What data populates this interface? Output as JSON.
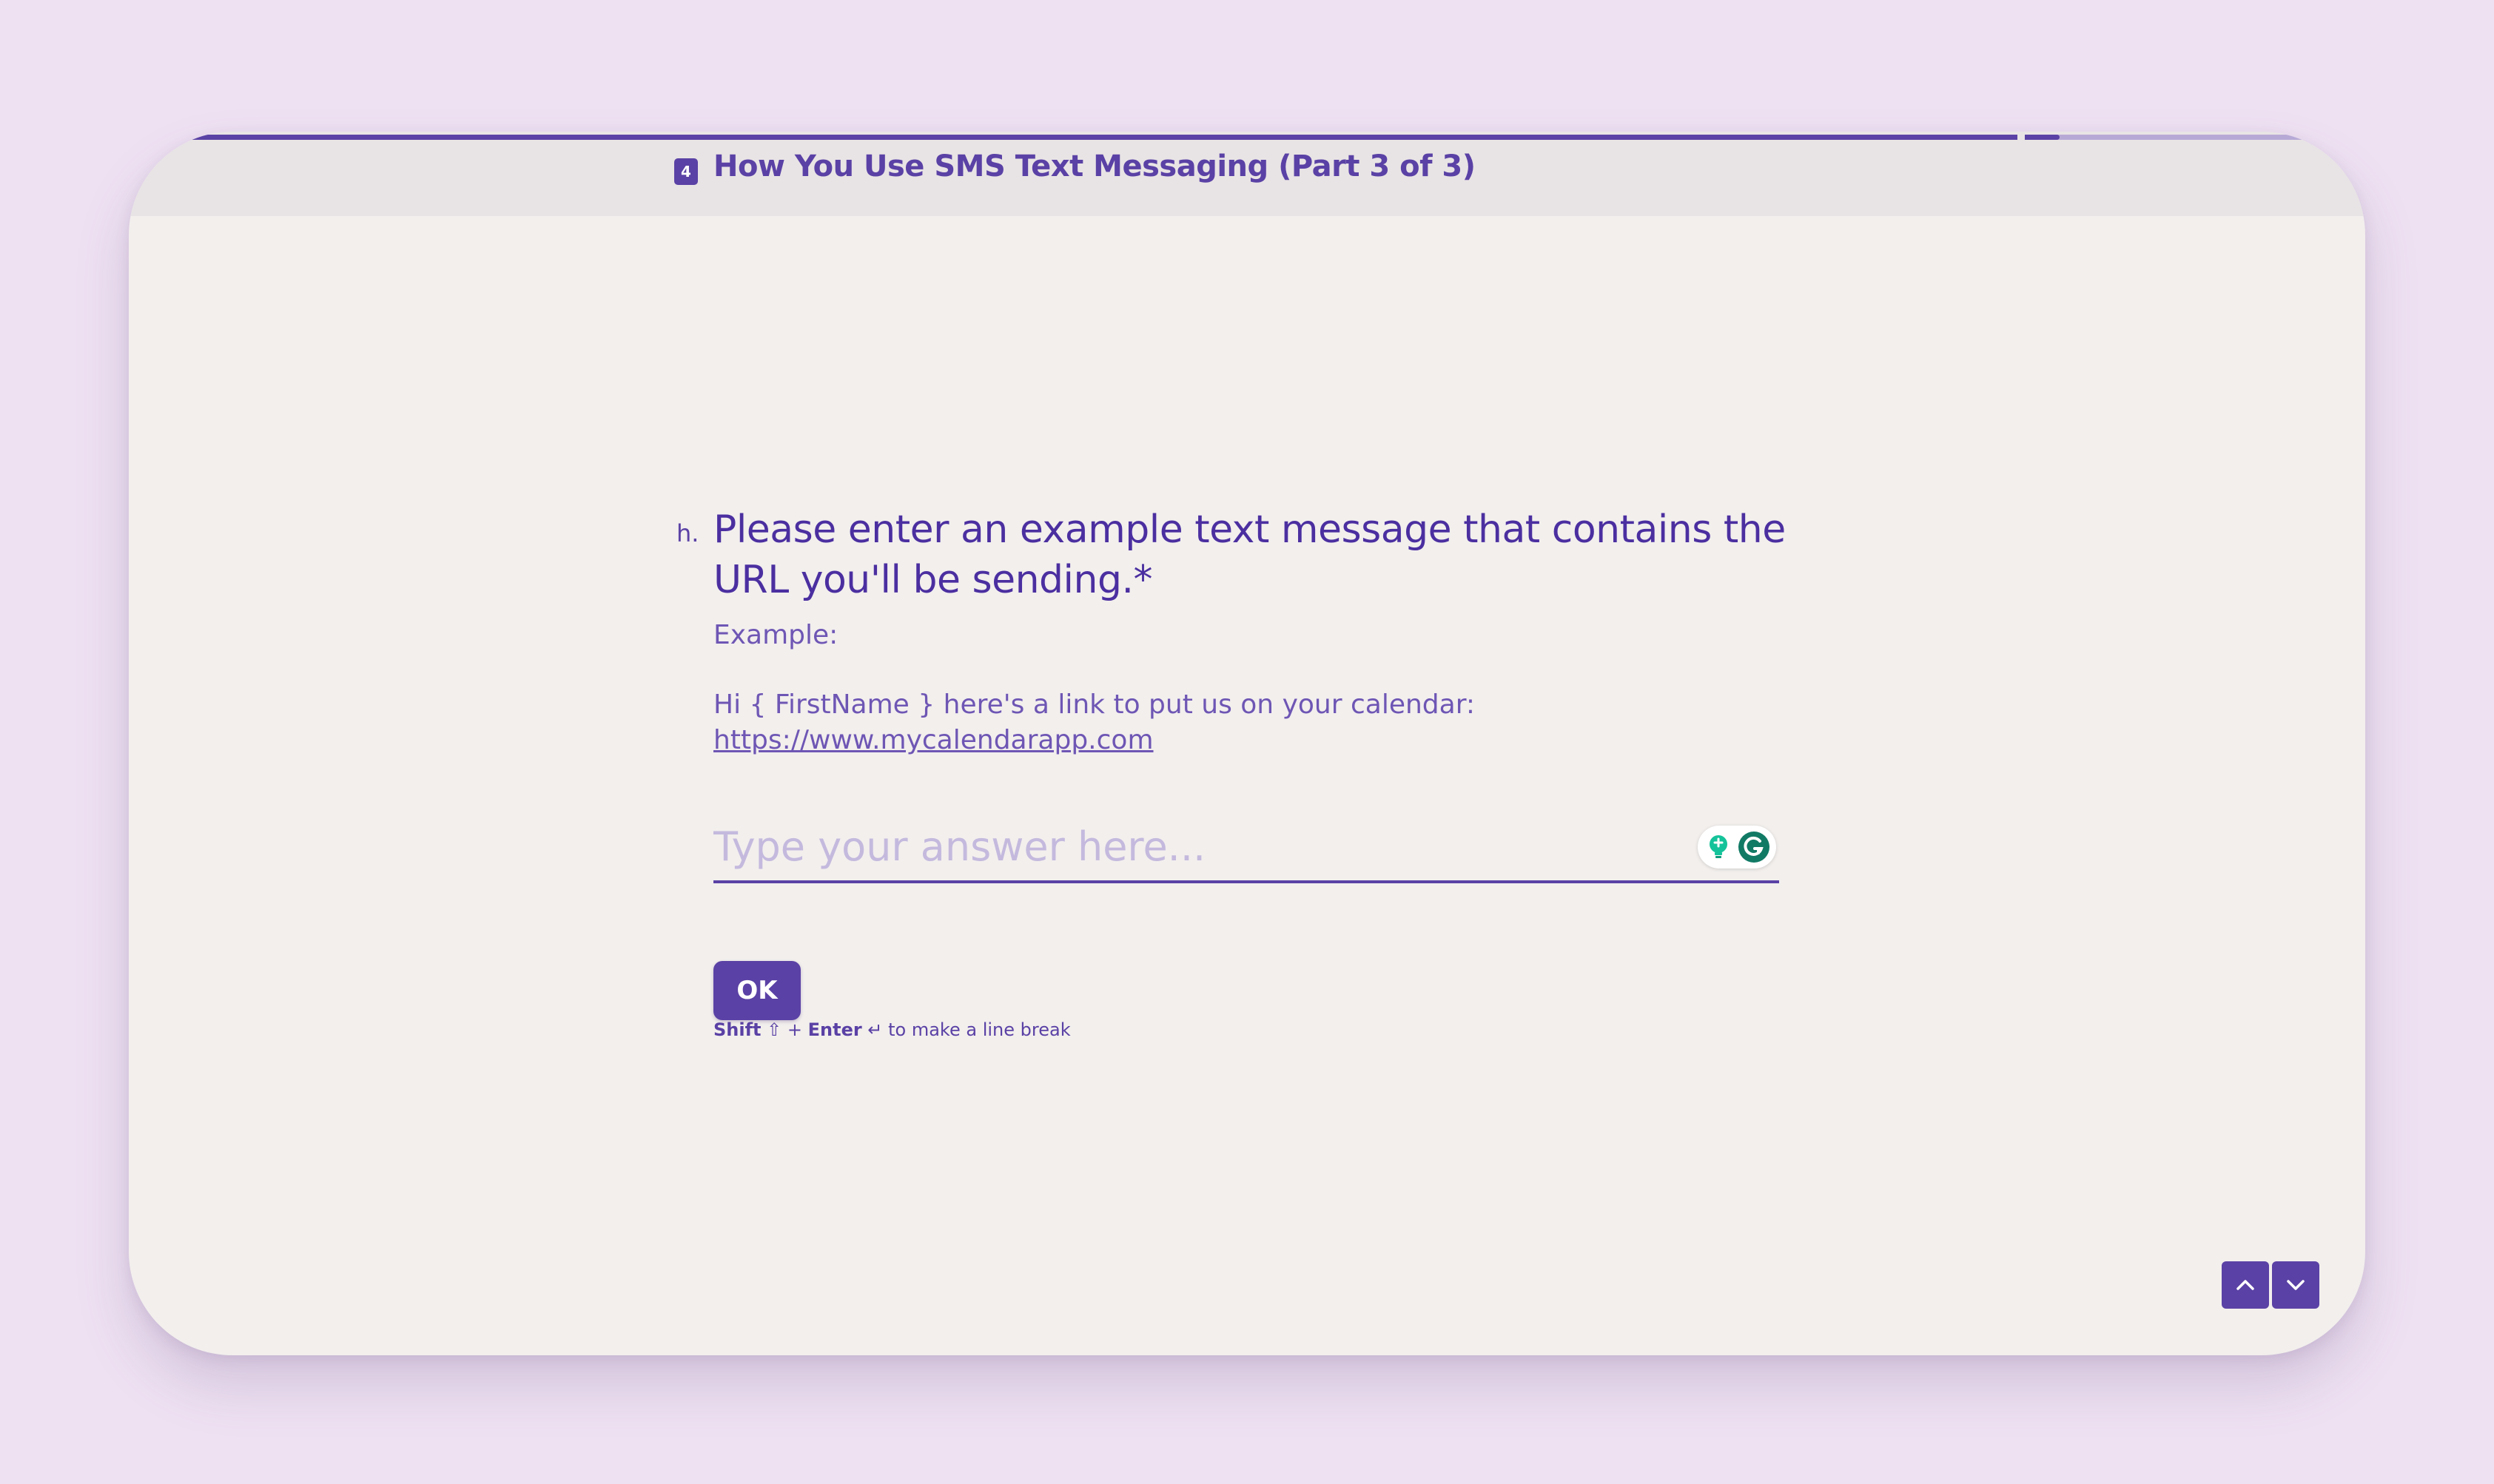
{
  "header": {
    "section_number": "4",
    "section_title": "How You Use SMS Text Messaging (Part 3 of 3)",
    "progress": 0.88
  },
  "question": {
    "letter": "h.",
    "text": "Please enter an example text message that contains the URL you'll be sending.*",
    "description_label": "Example:",
    "description_message": "Hi { FirstName } here's a link to put us on your calendar:",
    "description_link": "https://www.mycalendarapp.com"
  },
  "answer": {
    "placeholder": "Type your answer here...",
    "value": ""
  },
  "hint": {
    "key1": "Shift",
    "key1_symbol": "⇧",
    "plus": "+",
    "key2": "Enter",
    "key2_symbol": "↵",
    "suffix": "to make a line break"
  },
  "actions": {
    "ok_label": "OK"
  },
  "icons": {
    "bulb": "lightbulb-icon",
    "grammarly": "grammarly-icon",
    "up": "chevron-up-icon",
    "down": "chevron-down-icon"
  },
  "colors": {
    "accent": "#5a41a5",
    "background": "#eee1f2",
    "card": "#f2efed",
    "grammarly_green": "#15c39a"
  }
}
